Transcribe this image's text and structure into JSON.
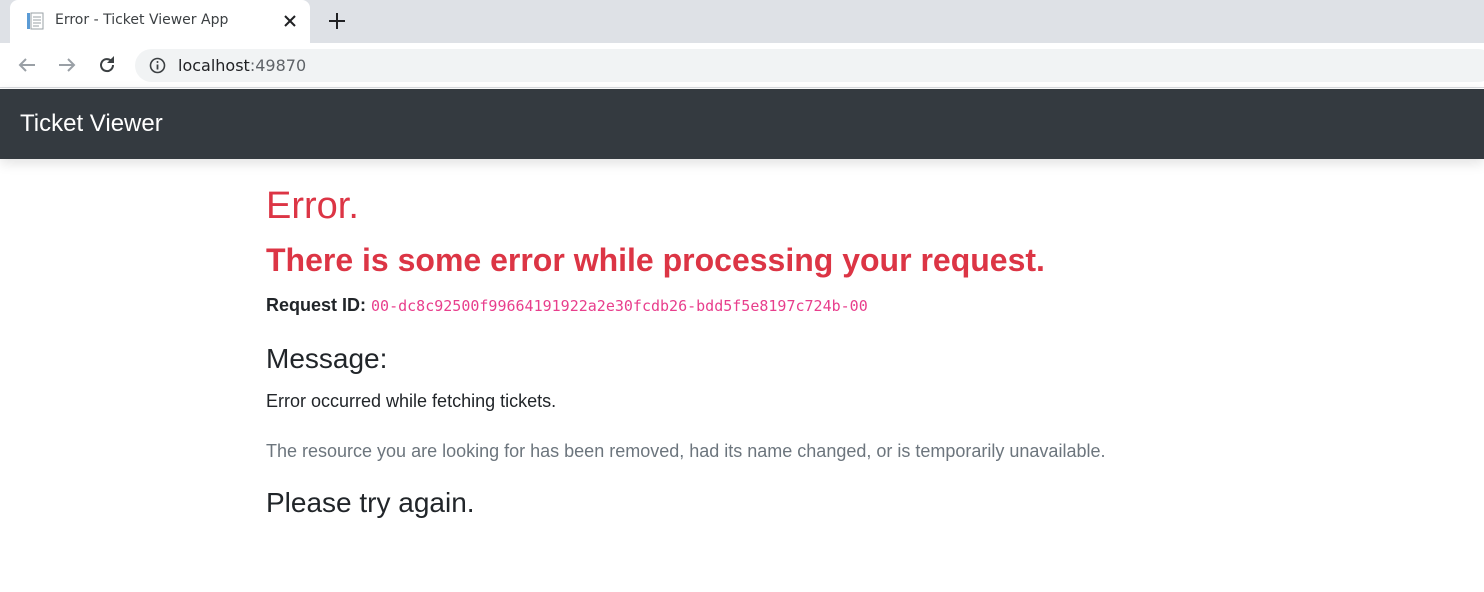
{
  "browser": {
    "tab_title": "Error - Ticket Viewer App",
    "url_host": "localhost",
    "url_port": ":49870"
  },
  "navbar": {
    "brand": "Ticket Viewer"
  },
  "error": {
    "title": "Error.",
    "subtitle": "There is some error while processing your request.",
    "request_id_label": "Request ID:",
    "request_id_value": "00-dc8c92500f99664191922a2e30fcdb26-bdd5f5e8197c724b-00",
    "message_heading": "Message:",
    "message_text": "Error occurred while fetching tickets.",
    "detail_text": "The resource you are looking for has been removed, had its name changed, or is temporarily unavailable.",
    "retry_text": "Please try again."
  },
  "colors": {
    "error_red": "#dc3545",
    "navbar_dark": "#343a40",
    "code_pink": "#e83e8c",
    "muted_gray": "#6c757d"
  },
  "icons": {
    "favicon": "document-icon",
    "close": "close-icon",
    "new_tab": "plus-icon",
    "back": "arrow-left-icon",
    "forward": "arrow-right-icon",
    "reload": "reload-icon",
    "site_info": "info-icon"
  }
}
